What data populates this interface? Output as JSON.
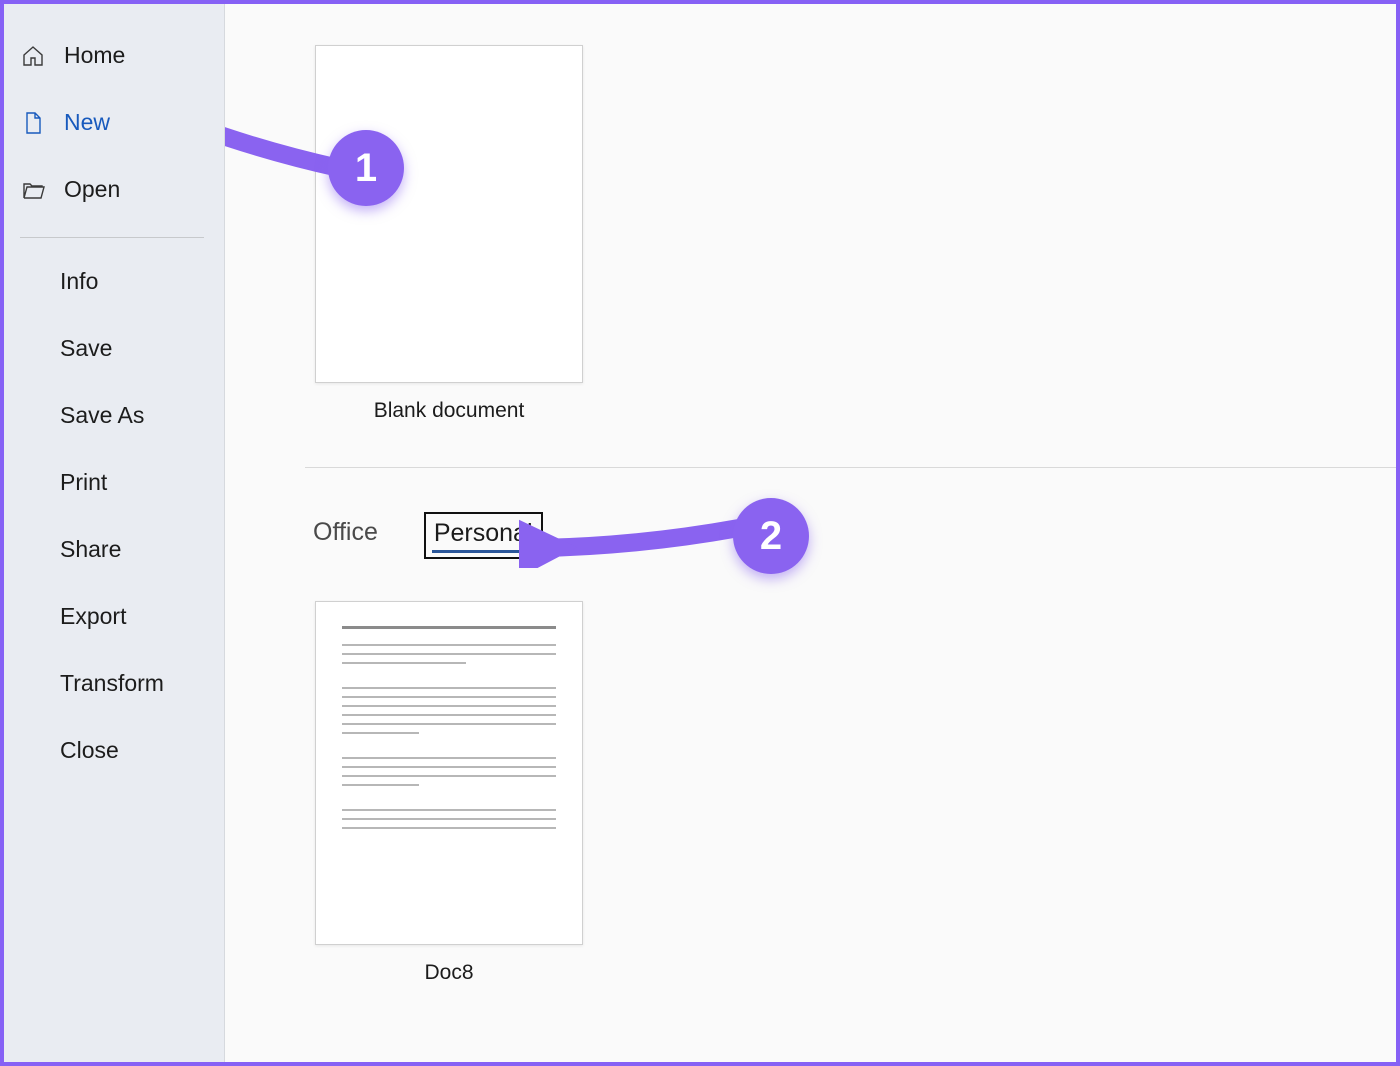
{
  "sidebar": {
    "primary": [
      {
        "label": "Home",
        "icon": "home"
      },
      {
        "label": "New",
        "icon": "page",
        "selected": true
      },
      {
        "label": "Open",
        "icon": "folder"
      }
    ],
    "secondary": [
      {
        "label": "Info"
      },
      {
        "label": "Save"
      },
      {
        "label": "Save As"
      },
      {
        "label": "Print"
      },
      {
        "label": "Share"
      },
      {
        "label": "Export"
      },
      {
        "label": "Transform"
      },
      {
        "label": "Close"
      }
    ]
  },
  "main": {
    "blank_template_label": "Blank document",
    "tabs": [
      {
        "label": "Office",
        "active": false
      },
      {
        "label": "Personal",
        "active": true
      }
    ],
    "personal_templates": [
      {
        "label": "Doc8"
      }
    ]
  },
  "annotations": {
    "badge1": "1",
    "badge2": "2"
  },
  "colors": {
    "sidebar_bg": "#e9ecf2",
    "accent": "#185abd",
    "annotation": "#8a63f0"
  }
}
